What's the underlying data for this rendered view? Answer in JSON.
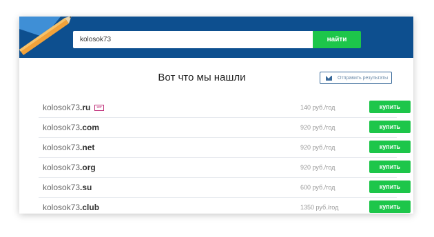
{
  "search": {
    "value": "kolosok73",
    "button_label": "найти"
  },
  "results_title": "Вот что мы нашли",
  "send_results_label": "Отправить результаты",
  "results": [
    {
      "name": "kolosok73",
      "zone": ".ru",
      "badge": "хит",
      "price": "140 руб./год",
      "buy_label": "купить"
    },
    {
      "name": "kolosok73",
      "zone": ".com",
      "badge": "",
      "price": "920 руб./год",
      "buy_label": "купить"
    },
    {
      "name": "kolosok73",
      "zone": ".net",
      "badge": "",
      "price": "920 руб./год",
      "buy_label": "купить"
    },
    {
      "name": "kolosok73",
      "zone": ".org",
      "badge": "",
      "price": "920 руб./год",
      "buy_label": "купить"
    },
    {
      "name": "kolosok73",
      "zone": ".su",
      "badge": "",
      "price": "600 руб./год",
      "buy_label": "купить"
    },
    {
      "name": "kolosok73",
      "zone": ".club",
      "badge": "",
      "price": "1350 руб./год",
      "buy_label": "купить"
    }
  ],
  "colors": {
    "header": "#0d4f8f",
    "accent_green": "#1dc64a",
    "badge": "#c0307a"
  },
  "icons": {
    "header_decor": "pencil-icon",
    "send": "mail-icon"
  }
}
